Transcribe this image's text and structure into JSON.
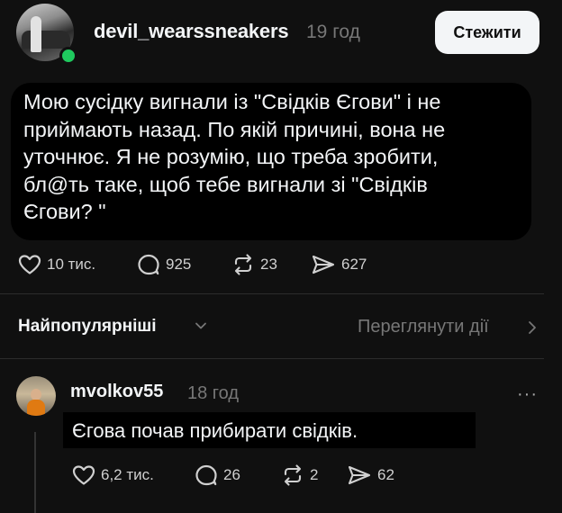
{
  "post": {
    "author": "devil_wearssneakers",
    "time": "19 год",
    "follow_label": "Стежити",
    "text": "Мою сусідку вигнали із \"Свідків Єгови\" і не\nприймають назад. По якій причині, вона не\nуточнює. Я не розумію, що треба зробити,\nбл@ть таке, щоб тебе вигнали зі \"Свідків\nЄгови? \"",
    "stats": {
      "likes": "10 тис.",
      "replies": "925",
      "reposts": "23",
      "shares": "627"
    }
  },
  "sort": {
    "label": "Найпопулярніші",
    "activity_label": "Переглянути дії"
  },
  "reply": {
    "author": "mvolkov55",
    "time": "18 год",
    "more": "···",
    "text": "Єгова почав прибирати свідків.",
    "stats": {
      "likes": "6,2 тис.",
      "replies": "26",
      "reposts": "2",
      "shares": "62"
    }
  },
  "colors": {
    "background": "#101010",
    "text_primary": "#f3f5f7",
    "text_secondary": "#777777",
    "online": "#1fc95e"
  },
  "icons": [
    "heart-icon",
    "comment-icon",
    "repost-icon",
    "share-icon",
    "chevron-down-icon",
    "chevron-right-icon"
  ]
}
